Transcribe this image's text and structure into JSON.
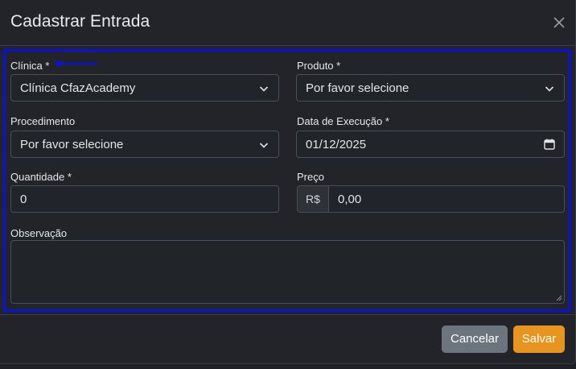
{
  "modal": {
    "title": "Cadastrar Entrada",
    "close_icon": "close-icon"
  },
  "form": {
    "clinica": {
      "label": "Clínica *",
      "value": "Clínica CfazAcademy"
    },
    "produto": {
      "label": "Produto *",
      "value": "Por favor selecione"
    },
    "procedimento": {
      "label": "Procedimento",
      "value": "Por favor selecione"
    },
    "data_execucao": {
      "label": "Data de Execução *",
      "value": "01/12/2025"
    },
    "quantidade": {
      "label": "Quantidade *",
      "value": "0"
    },
    "preco": {
      "label": "Preço",
      "prefix": "R$",
      "value": "0,00"
    },
    "observacao": {
      "label": "Observação",
      "value": ""
    }
  },
  "footer": {
    "cancel_label": "Cancelar",
    "save_label": "Salvar"
  },
  "colors": {
    "highlight_border": "#0a10e0",
    "save_button": "#e8951f",
    "cancel_button": "#6c757d"
  }
}
